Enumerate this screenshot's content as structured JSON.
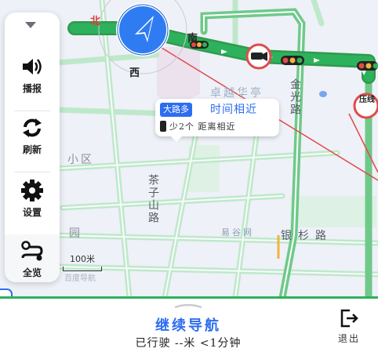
{
  "map": {
    "labels": {
      "north": "北",
      "south": "南",
      "west": "西",
      "area1": "卓越华亭",
      "area2": "金光路",
      "area3": "小区",
      "area4": "茶子山路",
      "area5": "易谷网",
      "road1": "银杉路",
      "area6": "园",
      "sign_pressure": "压线"
    }
  },
  "toolbar": {
    "broadcast_label": "播报",
    "refresh_label": "刷新",
    "settings_label": "设置",
    "overview_label": "全览"
  },
  "route_bubble": {
    "tag": "大路多",
    "title": "时间相近",
    "detail": "少2个 距离相近"
  },
  "scale": {
    "label": "100米",
    "watermark": "百度导航"
  },
  "bottom": {
    "continue_label": "继续导航",
    "trip_info": "已行驶 --米 <1分钟",
    "exit_label": "退出"
  },
  "colors": {
    "route_green": "#2eb15c",
    "accent_blue": "#2d6df0",
    "road_green_light": "#9fdfb3",
    "red_line": "#e04b4b"
  }
}
